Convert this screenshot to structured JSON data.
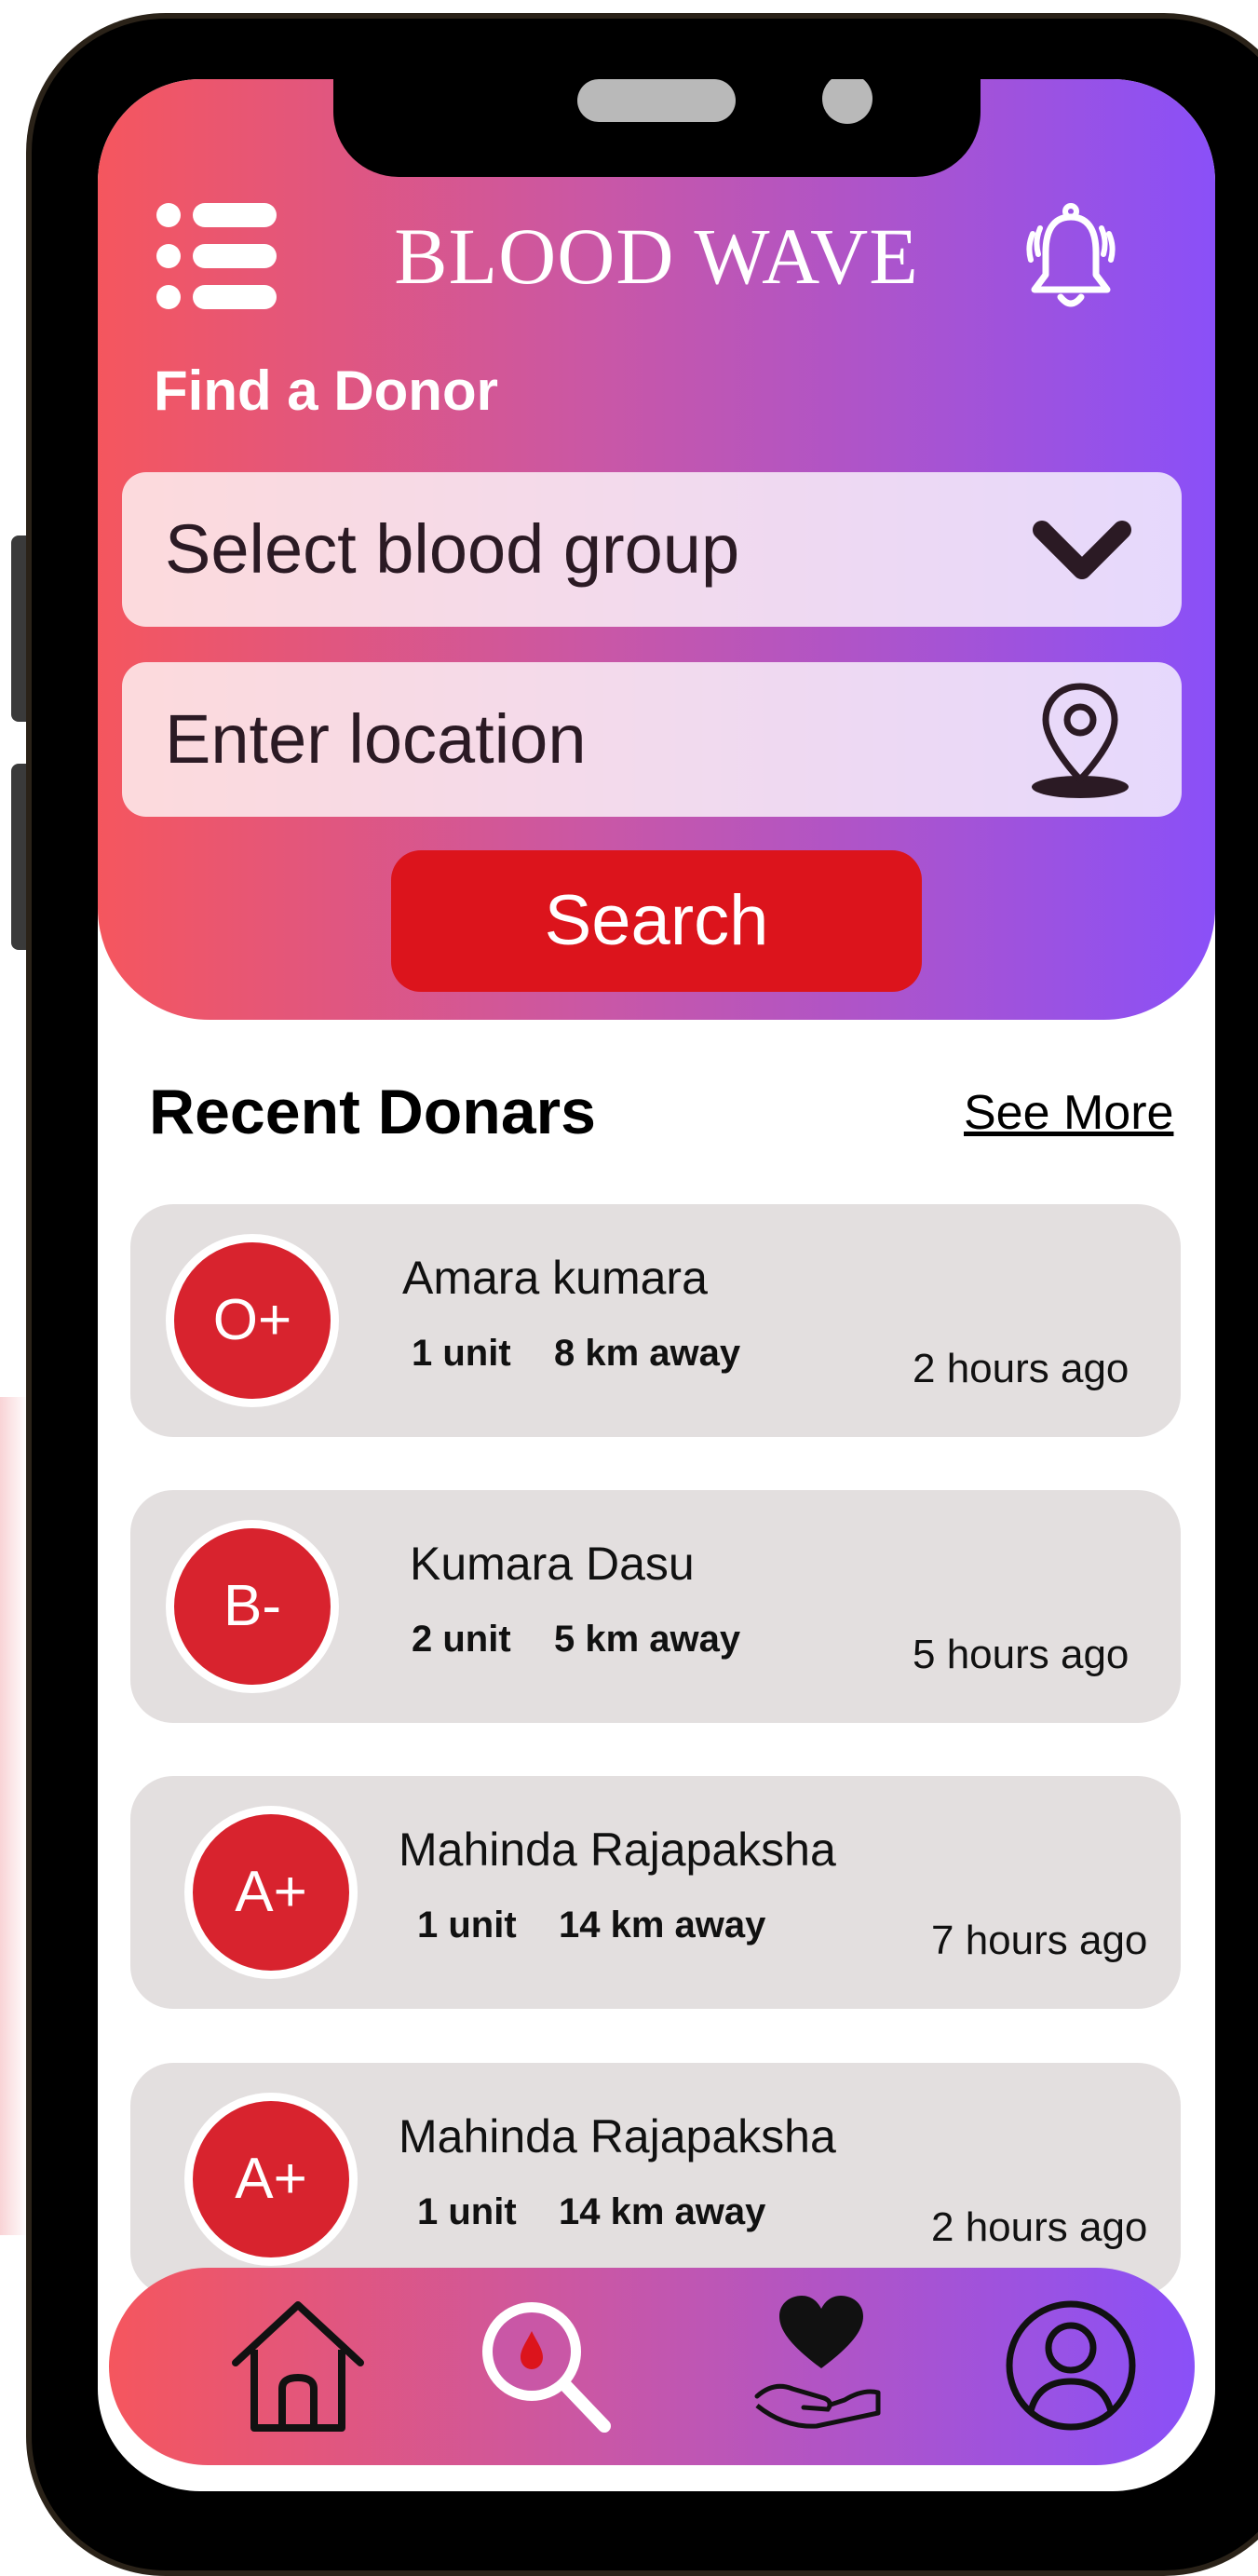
{
  "app": {
    "title": "BLOOD WAVE"
  },
  "finder": {
    "title": "Find a Donor",
    "blood_group_placeholder": "Select blood group",
    "location_placeholder": "Enter location",
    "search_label": "Search"
  },
  "recent": {
    "title": "Recent Donars",
    "see_more": "See More",
    "donors": [
      {
        "group": "O+",
        "name": "Amara kumara",
        "units": "1 unit",
        "distance": "8 km away",
        "time": "2 hours ago"
      },
      {
        "group": "B-",
        "name": "Kumara  Dasu",
        "units": "2 unit",
        "distance": "5 km away",
        "time": "5 hours ago"
      },
      {
        "group": "A+",
        "name": "Mahinda Rajapaksha",
        "units": "1 unit",
        "distance": "14 km away",
        "time": "7 hours ago"
      },
      {
        "group": "A+",
        "name": "Mahinda Rajapaksha",
        "units": "1 unit",
        "distance": "14 km away",
        "time": "2 hours ago"
      }
    ]
  },
  "nav": {
    "items": [
      {
        "icon": "home-icon"
      },
      {
        "icon": "search-blood-icon"
      },
      {
        "icon": "donate-heart-icon"
      },
      {
        "icon": "profile-icon"
      }
    ]
  },
  "colors": {
    "gradient_start": "#f5565e",
    "gradient_mid": "#c957a6",
    "gradient_end": "#8a50f8",
    "accent_red": "#dc141c",
    "badge_red": "#d8232e",
    "card_bg": "#e3dfdf"
  }
}
